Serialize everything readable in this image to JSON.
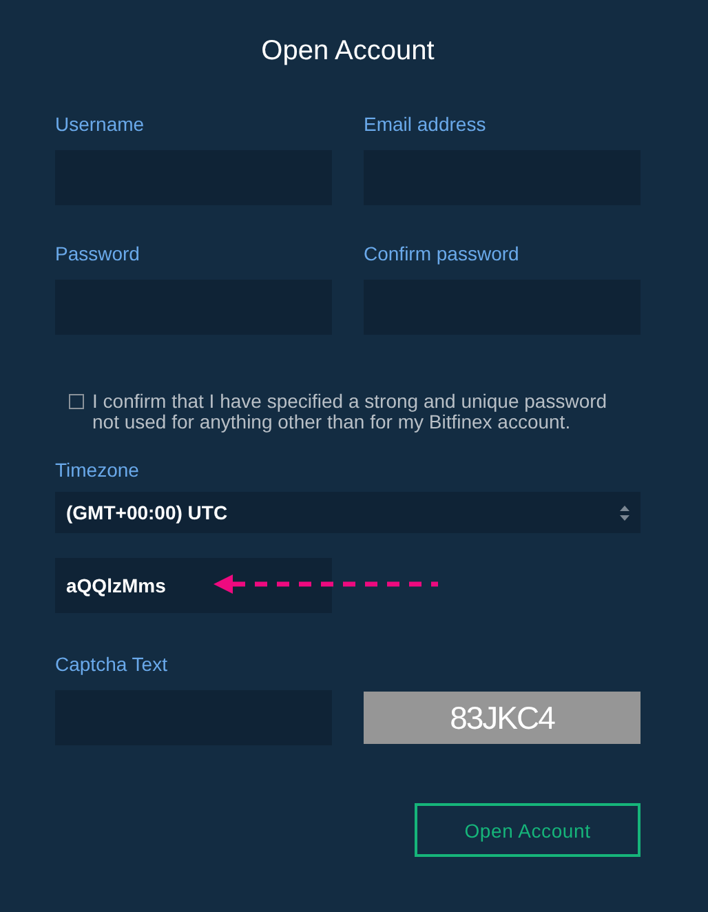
{
  "title": "Open Account",
  "fields": [
    {
      "label": "Username"
    },
    {
      "label": "Email address"
    },
    {
      "label": "Password"
    },
    {
      "label": "Confirm password"
    }
  ],
  "confirm": {
    "checked": false,
    "text": "I confirm that I have specified a strong and unique password not used for anything other than for my Bitfinex account."
  },
  "timezone": {
    "label": "Timezone",
    "value": "(GMT+00:00) UTC"
  },
  "code_field": {
    "value": "aQQlzMms"
  },
  "captcha": {
    "label": "Captcha Text",
    "image_text": "83JKC4"
  },
  "submit": "Open Account"
}
